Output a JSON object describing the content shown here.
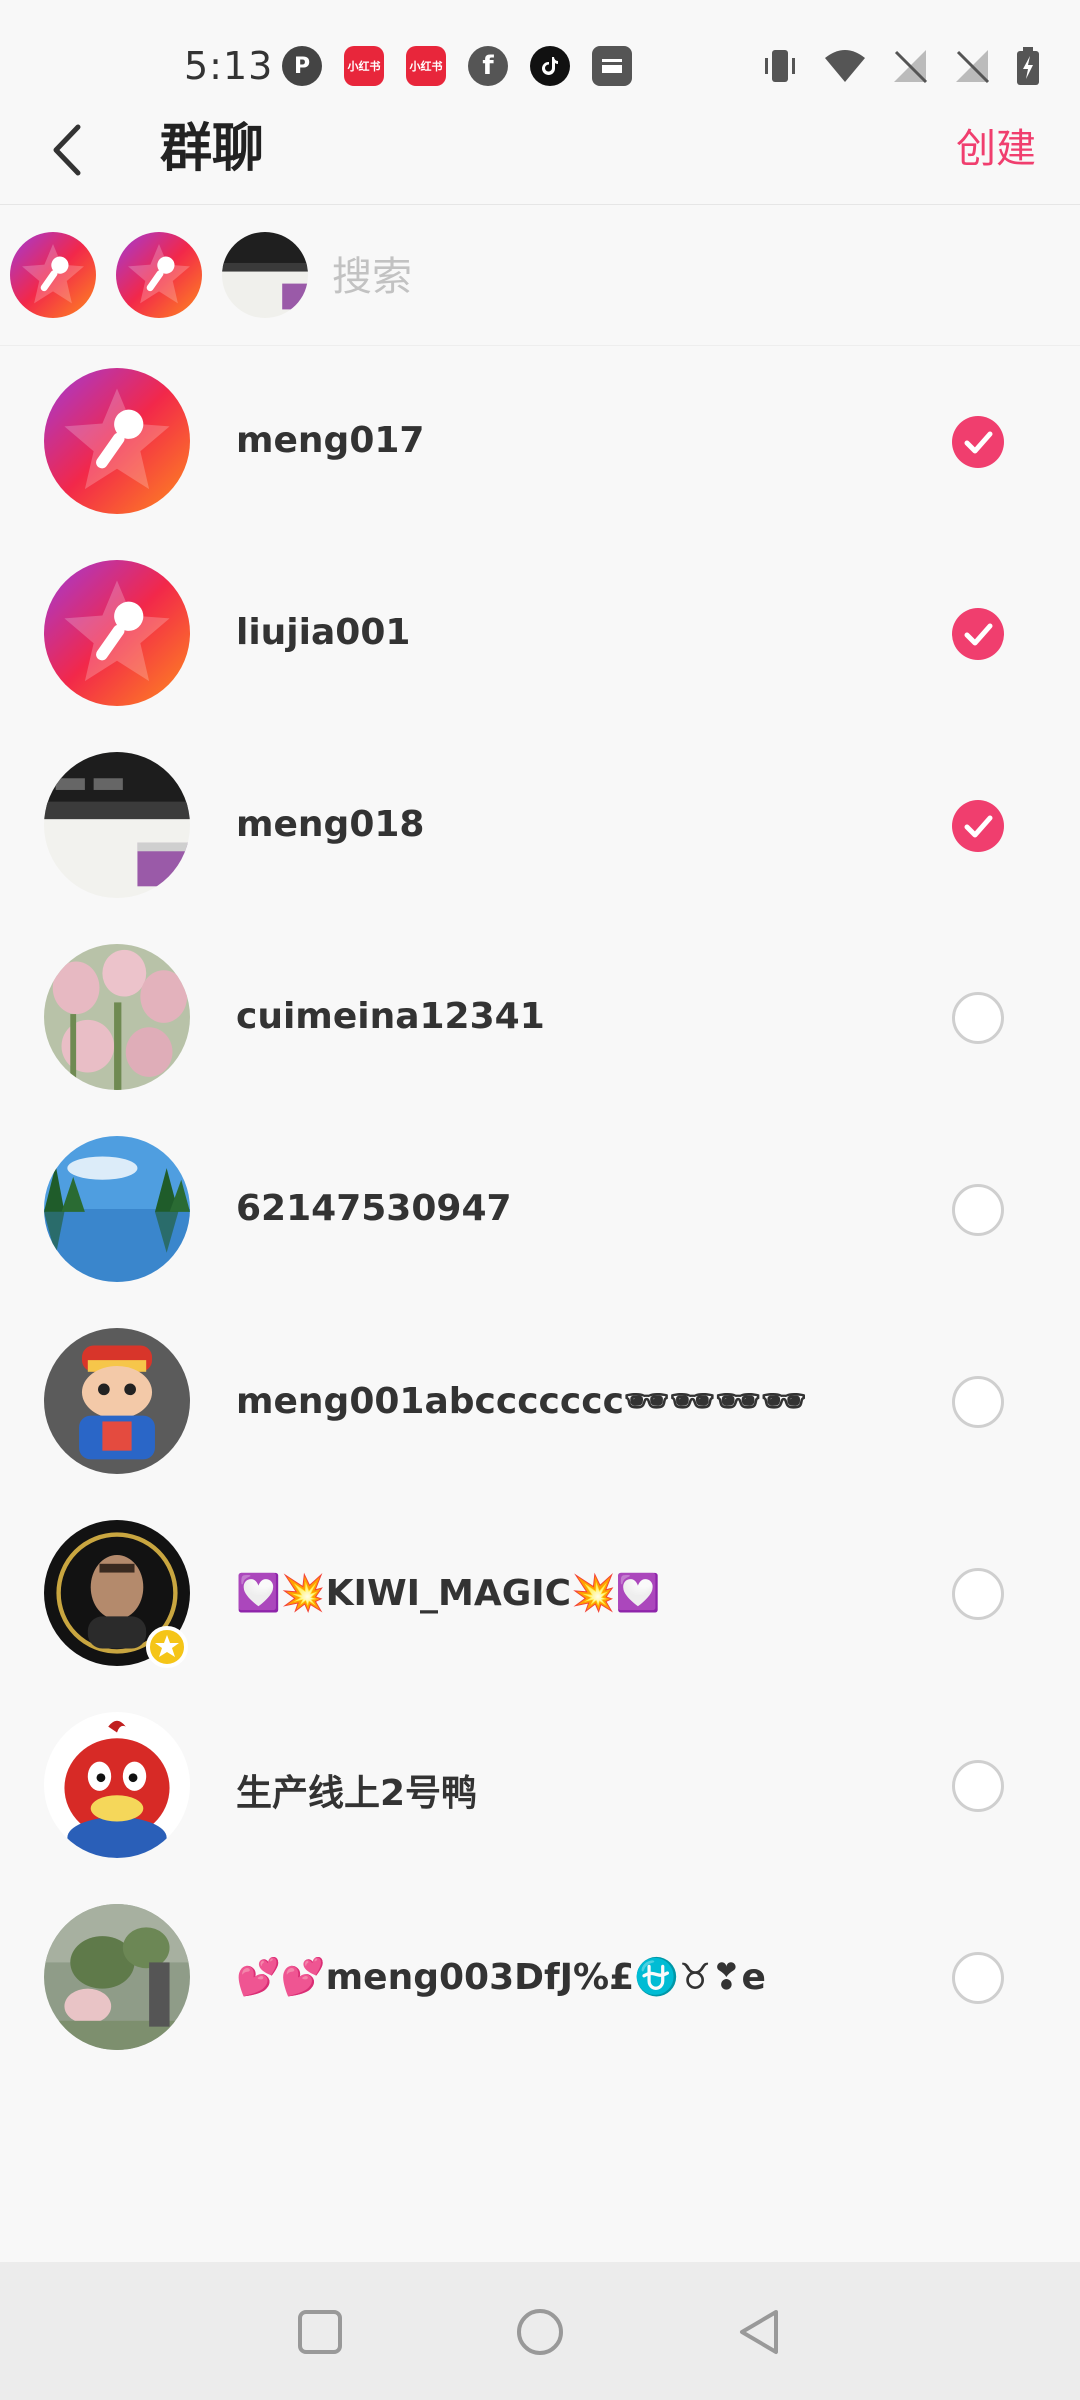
{
  "status_bar": {
    "time": "5:13",
    "left_icons": [
      "p-app-icon",
      "xiaohongshu-icon",
      "xiaohongshu-icon",
      "facebook-icon",
      "tiktok-icon",
      "inbox-icon"
    ],
    "xhs_label": "小红书",
    "right_icons": [
      "vibrate-icon",
      "wifi-icon",
      "no-signal-icon",
      "no-signal-icon",
      "battery-charging-icon"
    ]
  },
  "header": {
    "title": "群聊",
    "create_label": "创建",
    "back_icon": "chevron-left-icon"
  },
  "search": {
    "placeholder": "搜索"
  },
  "contacts": [
    {
      "name": "meng017",
      "selected": true,
      "avatar": "karaoke-star"
    },
    {
      "name": "liujia001",
      "selected": true,
      "avatar": "karaoke-star"
    },
    {
      "name": "meng018",
      "selected": true,
      "avatar": "photo-dark"
    },
    {
      "name": "cuimeina12341",
      "selected": false,
      "avatar": "photo-tulips"
    },
    {
      "name": "62147530947",
      "selected": false,
      "avatar": "photo-lake"
    },
    {
      "name": "meng001abccccccc🕶🕶🕶🕶",
      "selected": false,
      "avatar": "photo-toy"
    },
    {
      "name": "💟💥KIWI_MAGIC💥💟",
      "selected": false,
      "avatar": "photo-portrait"
    },
    {
      "name": "生产线上2号鸭",
      "selected": false,
      "avatar": "cartoon-duck"
    },
    {
      "name": "💕💕meng003DfJ%£⛎♉❣e",
      "selected": false,
      "avatar": "photo-plant"
    }
  ],
  "colors": {
    "accent": "#f03e6e",
    "text": "#333333",
    "placeholder": "#c2c2c2"
  },
  "nav": [
    "recent-apps-icon",
    "home-icon",
    "back-icon"
  ]
}
